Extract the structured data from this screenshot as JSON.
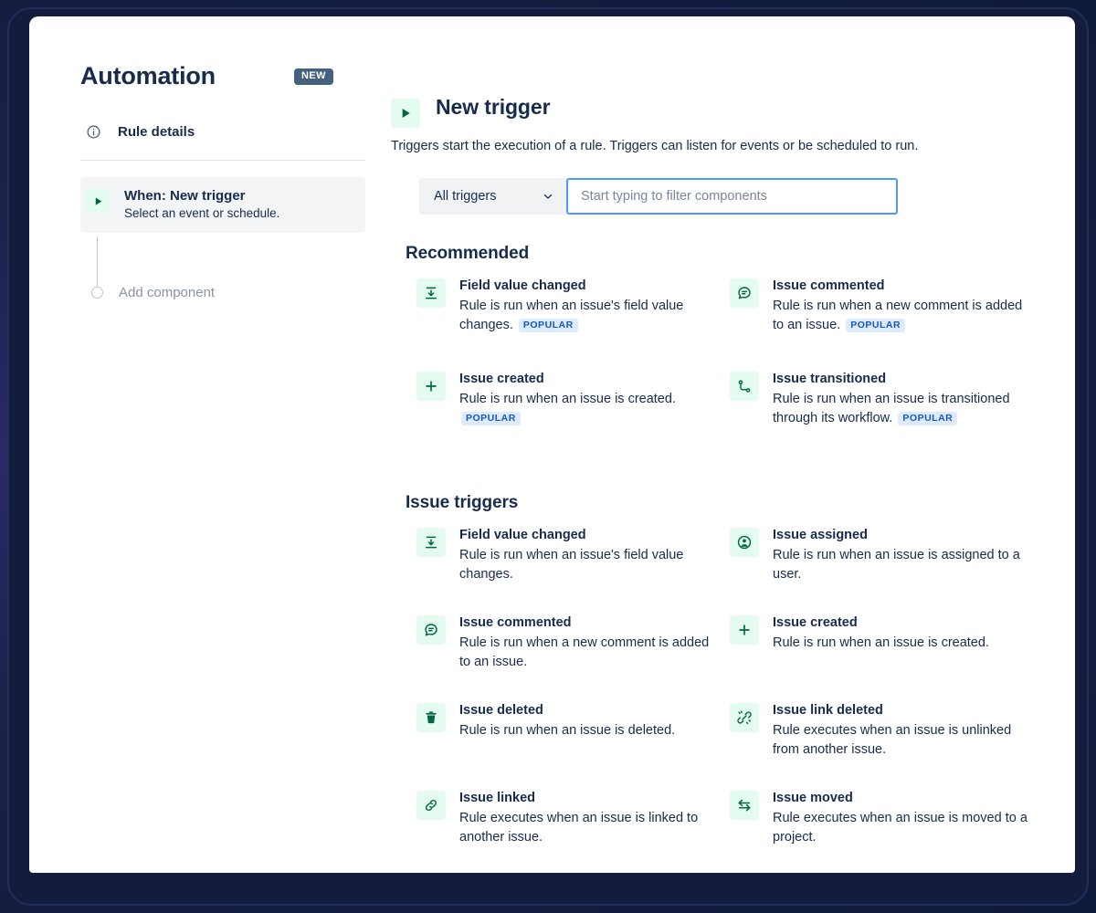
{
  "header": {
    "title": "Automation",
    "badge": "NEW"
  },
  "sidebar": {
    "rule_details": {
      "label": "Rule details",
      "icon": "info-circle-icon"
    },
    "when_item": {
      "title": "When: New trigger",
      "subtitle": "Select an event or schedule.",
      "icon": "play-triangle-icon"
    },
    "add_component": {
      "label": "Add component",
      "icon": "empty-circle-icon"
    }
  },
  "main": {
    "title": "New trigger",
    "icon": "play-triangle-icon",
    "description": "Triggers start the execution of a rule. Triggers can listen for events or be scheduled to run.",
    "filter": {
      "select_value": "All triggers",
      "select_icon": "chevron-down-icon",
      "input_value": "",
      "input_placeholder": "Start typing to filter components"
    },
    "sections": [
      {
        "title": "Recommended",
        "items": [
          {
            "icon": "field-value-changed-icon",
            "title": "Field value changed",
            "desc": "Rule is run when an issue's field value changes.",
            "badge": "POPULAR"
          },
          {
            "icon": "comment-icon",
            "title": "Issue commented",
            "desc": "Rule is run when a new comment is added to an issue.",
            "badge": "POPULAR"
          },
          {
            "icon": "plus-icon",
            "title": "Issue created",
            "desc": "Rule is run when an issue is created.",
            "badge": "POPULAR"
          },
          {
            "icon": "transition-icon",
            "title": "Issue transitioned",
            "desc": "Rule is run when an issue is transitioned through its workflow.",
            "badge": "POPULAR"
          }
        ]
      },
      {
        "title": "Issue triggers",
        "items": [
          {
            "icon": "field-value-changed-icon",
            "title": "Field value changed",
            "desc": "Rule is run when an issue's field value changes.",
            "badge": ""
          },
          {
            "icon": "person-icon",
            "title": "Issue assigned",
            "desc": "Rule is run when an issue is assigned to a user.",
            "badge": ""
          },
          {
            "icon": "comment-icon",
            "title": "Issue commented",
            "desc": "Rule is run when a new comment is added to an issue.",
            "badge": ""
          },
          {
            "icon": "plus-icon",
            "title": "Issue created",
            "desc": "Rule is run when an issue is created.",
            "badge": ""
          },
          {
            "icon": "trash-icon",
            "title": "Issue deleted",
            "desc": "Rule is run when an issue is deleted.",
            "badge": ""
          },
          {
            "icon": "broken-link-icon",
            "title": "Issue link deleted",
            "desc": "Rule executes when an issue is unlinked from another issue.",
            "badge": ""
          },
          {
            "icon": "link-icon",
            "title": "Issue linked",
            "desc": "Rule executes when an issue is linked to another issue.",
            "badge": ""
          },
          {
            "icon": "move-arrows-icon",
            "title": "Issue moved",
            "desc": "Rule executes when an issue is moved to a project.",
            "badge": ""
          }
        ]
      }
    ]
  },
  "colors": {
    "text": "#172b4d",
    "icon_green": "#006644",
    "icon_tile_bg": "#e3fcef",
    "badge_new_bg": "#44617f",
    "badge_popular_bg": "#deebff",
    "badge_popular_text": "#1558bc",
    "focus_border": "#4c9aff",
    "select_bg": "#f1f2f4",
    "frame_navy": "#1a2247"
  }
}
